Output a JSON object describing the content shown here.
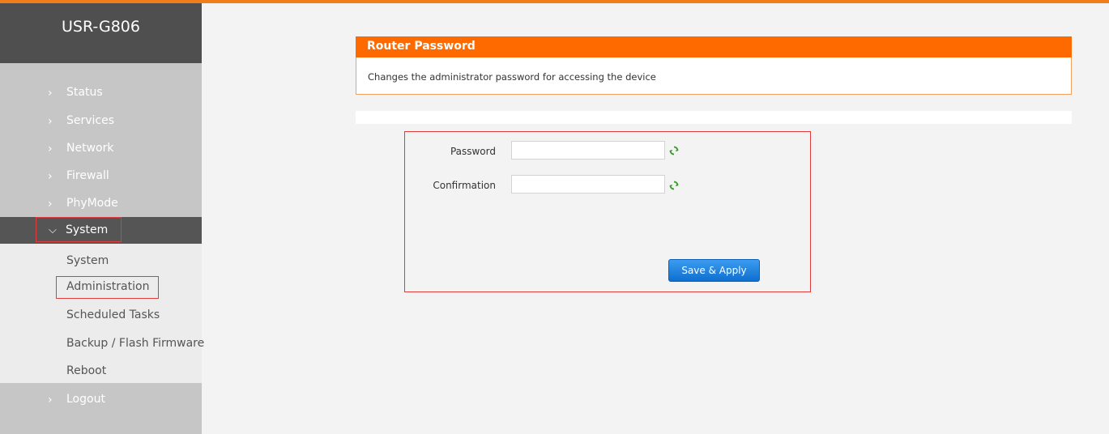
{
  "brand": {
    "title": "USR-G806"
  },
  "sidebar": {
    "items": [
      {
        "label": "Status"
      },
      {
        "label": "Services"
      },
      {
        "label": "Network"
      },
      {
        "label": "Firewall"
      },
      {
        "label": "PhyMode"
      },
      {
        "label": "System"
      },
      {
        "label": "Logout"
      }
    ],
    "submenu": [
      {
        "label": "System"
      },
      {
        "label": "Administration"
      },
      {
        "label": "Scheduled Tasks"
      },
      {
        "label": "Backup / Flash Firmware"
      },
      {
        "label": "Reboot"
      }
    ]
  },
  "panel": {
    "title": "Router Password",
    "description": "Changes the administrator password for accessing the device"
  },
  "form": {
    "password_label": "Password",
    "password_value": "",
    "confirmation_label": "Confirmation",
    "confirmation_value": "",
    "save_label": "Save & Apply"
  },
  "colors": {
    "accent": "#ff6a00",
    "sidebar_bg": "#c6c6c6",
    "sidebar_active": "#555555",
    "highlight_border": "#e23b3b",
    "button": "#1a7fd8"
  }
}
